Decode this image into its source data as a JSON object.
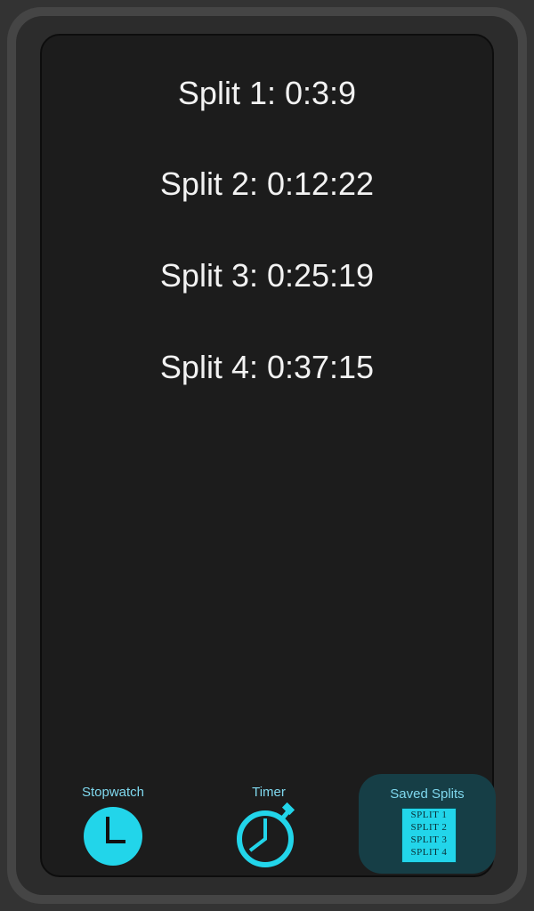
{
  "splits": [
    "Split 1: 0:3:9",
    "Split 2: 0:12:22",
    "Split 3: 0:25:19",
    "Split 4: 0:37:15"
  ],
  "nav": {
    "stopwatch": {
      "label": "Stopwatch",
      "icon": "clock-icon"
    },
    "timer": {
      "label": "Timer",
      "icon": "stopwatch-icon"
    },
    "saved": {
      "label": "Saved Splits",
      "icon": "split-list-icon",
      "icon_lines": [
        "SPLIT 1",
        "SPLIT 2",
        "SPLIT 3",
        "SPLIT 4"
      ],
      "selected": true
    }
  },
  "colors": {
    "accent": "#22d5ea",
    "screen_bg": "#1c1c1c",
    "text": "#f2f2f2",
    "active_tab_bg": "#163e46"
  }
}
